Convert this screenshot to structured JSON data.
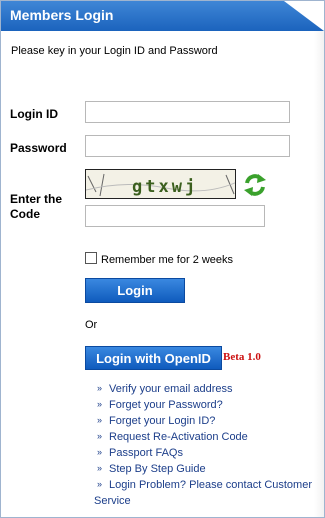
{
  "header": {
    "title": "Members Login"
  },
  "intro_text": "Please key in your Login ID and Password",
  "login_id": {
    "label": "Login ID",
    "value": ""
  },
  "password": {
    "label": "Password",
    "value": ""
  },
  "captcha": {
    "label_line1": "Enter the",
    "label_line2": "Code",
    "image_text": "gtxwj",
    "value": "",
    "refresh_icon": "refresh-arrows-icon"
  },
  "remember": {
    "label": "Remember me for 2 weeks",
    "checked": false
  },
  "login_button": "Login",
  "or_text": "Or",
  "openid_button": "Login with OpenID",
  "beta_label": "Beta 1.0",
  "links": [
    "Verify your email address",
    "Forget your Password?",
    "Forget your Login ID?",
    "Request Re-Activation Code",
    "Passport FAQs",
    "Step By Step Guide",
    "Login Problem? Please contact Customer Service"
  ],
  "colors": {
    "header": "#1b63bd",
    "button": "#1a6fd0",
    "link": "#1c3e8a",
    "beta": "#cc1111"
  }
}
